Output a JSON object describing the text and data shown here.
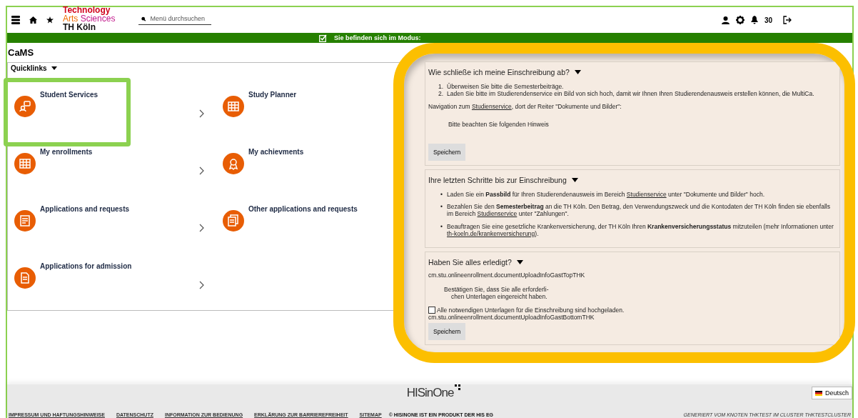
{
  "header": {
    "logo": {
      "line_1": "Technology",
      "line_2a": "Arts",
      "line_2b": "Sciences",
      "line_3": "TH Köln"
    },
    "search": {
      "placeholder": "Menü durchsuchen"
    },
    "notification_count": "30"
  },
  "mode_banner": {
    "text": "Sie befinden sich im Modus:"
  },
  "page_title": "CaMS",
  "quicklinks": {
    "title": "Quicklinks",
    "tiles": [
      {
        "title": "Student Services",
        "kind": "service",
        "highlighted": true
      },
      {
        "title": "Study Planner",
        "kind": "planner",
        "highlighted": false
      },
      {
        "title": "My enrollments",
        "kind": "table",
        "highlighted": false
      },
      {
        "title": "My achievments",
        "kind": "award",
        "highlighted": false
      },
      {
        "title": "Applications and requests",
        "kind": "form",
        "highlighted": false
      },
      {
        "title": "Other applications and requests",
        "kind": "documents",
        "highlighted": false
      },
      {
        "title": "Applications for admission",
        "kind": "document",
        "highlighted": false
      }
    ]
  },
  "enrollment": {
    "sections": [
      {
        "title": "Wie schließe ich meine Einschreibung ab?",
        "expanded": true,
        "steps": [
          {
            "marker": "1.",
            "text": "Überweisen Sie bitte die Semesterbeiträge."
          },
          {
            "marker": "2.",
            "text": "Laden Sie bitte im Studierendenservice ein Bild von sich hoch, damit wir Ihnen Ihren Studierendenausweis erstellen können, die MultiCa."
          }
        ],
        "navigation": [
          {
            "kind": "text",
            "text": "Navigation zum "
          },
          {
            "kind": "link",
            "text": "Studienservice"
          },
          {
            "kind": "text",
            "text": ", dort der Reiter \"Dokumente und Bilder\":"
          }
        ],
        "note": "Bitte beachten Sie folgenden Hinweis",
        "button": "Speichern"
      },
      {
        "title": "Ihre letzten Schritte bis zur Einschreibung",
        "expanded": true,
        "bullets": [
          {
            "marker": "•",
            "parts": [
              {
                "kind": "text",
                "text": "Laden Sie ein "
              },
              {
                "kind": "bold",
                "text": "Passbild"
              },
              {
                "kind": "text",
                "text": " für Ihren Studierendenausweis im Bereich "
              },
              {
                "kind": "link",
                "text": "Studienservice"
              },
              {
                "kind": "text",
                "text": " unter \"Dokumente und Bilder\" hoch."
              }
            ]
          },
          {
            "marker": "•",
            "parts": [
              {
                "kind": "text",
                "text": "Bezahlen Sie den "
              },
              {
                "kind": "bold",
                "text": "Semesterbeitrag"
              },
              {
                "kind": "text",
                "text": " an die TH Köln. Den Betrag, den Verwendungszweck und die Kontodaten der TH Köln finden sie ebenfalls im Bereich "
              },
              {
                "kind": "link",
                "text": "Studienservice"
              },
              {
                "kind": "text",
                "text": " unter \"Zahlungen\"."
              }
            ]
          },
          {
            "marker": "•",
            "parts": [
              {
                "kind": "text",
                "text": "Beauftragen Sie eine gesetzliche Krankenversicherung, der TH Köln Ihren "
              },
              {
                "kind": "bold",
                "text": "Krankenversicherungsstatus"
              },
              {
                "kind": "text",
                "text": " mitzuteilen (mehr Informationen unter "
              },
              {
                "kind": "link",
                "text": "th-koeln.de/krankenversicherung"
              },
              {
                "kind": "text",
                "text": ")."
              }
            ]
          }
        ]
      },
      {
        "title": "Haben Sie alles erledigt?",
        "expanded": true,
        "top_key": "cm.stu.onlineenrollment.documentUploadInfoGastTopTHK",
        "confirm_lines": [
          "Bestätigen Sie, dass Sie alle erforderli-",
          "chen Unterlagen eingereicht haben."
        ],
        "checkbox": {
          "label": "Alle notwendigen Unterlagen für die Einschreibung sind hochgeladen.",
          "checked": false
        },
        "bottom_key": "cm.stu.onlineenrollment.documentUploadInfoGastBottomTHK",
        "button": "Speichern"
      }
    ]
  },
  "footer": {
    "logo": "HISinOne",
    "language": "Deutsch",
    "links": [
      "IMPRESSUM UND HAFTUNGSHINWEISE",
      "DATENSCHUTZ",
      "INFORMATION ZUR BEDIENUNG",
      "ERKLÄRUNG ZUR BARRIEREFREIHEIT",
      "SITEMAP"
    ],
    "copyright": "© HISINONE IST EIN PRODUKT DER HIS EG",
    "generated": "GENERIERT VOM KNOTEN THKTEST IM CLUSTER THKTESTCLUSTER"
  }
}
